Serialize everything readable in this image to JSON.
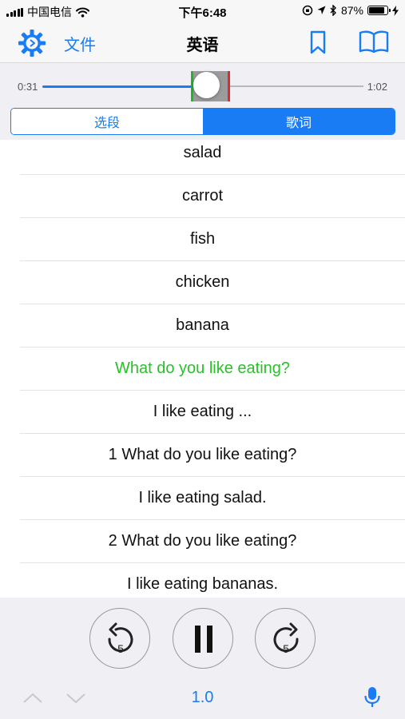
{
  "status_bar": {
    "carrier": "中国电信",
    "time": "下午6:48",
    "battery": "87%",
    "battery_level": 0.87
  },
  "nav": {
    "settings_icon": "gear-icon",
    "file_label": "文件",
    "title": "英语",
    "bookmark_icon": "bookmark-icon",
    "book_icon": "open-book-icon"
  },
  "player": {
    "current_time": "0:31",
    "total_time": "1:02",
    "progress": 0.5
  },
  "tabs": {
    "segment_label": "选段",
    "lyrics_label": "歌词",
    "selected": "歌词"
  },
  "lyrics": [
    {
      "text": "salad",
      "active": false
    },
    {
      "text": "carrot",
      "active": false
    },
    {
      "text": "fish",
      "active": false
    },
    {
      "text": "chicken",
      "active": false
    },
    {
      "text": "banana",
      "active": false
    },
    {
      "text": "What do you like eating?",
      "active": true
    },
    {
      "text": "I like eating ...",
      "active": false
    },
    {
      "text": "1 What do you like eating?",
      "active": false
    },
    {
      "text": "I like eating salad.",
      "active": false
    },
    {
      "text": "2 What do you like eating?",
      "active": false
    },
    {
      "text": "I like eating bananas.",
      "active": false
    }
  ],
  "controls": {
    "rewind_seconds": "5",
    "forward_seconds": "5",
    "speed": "1.0"
  },
  "colors": {
    "accent": "#1a7cf5",
    "active_lyric": "#2ac02a",
    "loop_start": "#1eb829",
    "loop_end": "#e0282e"
  }
}
